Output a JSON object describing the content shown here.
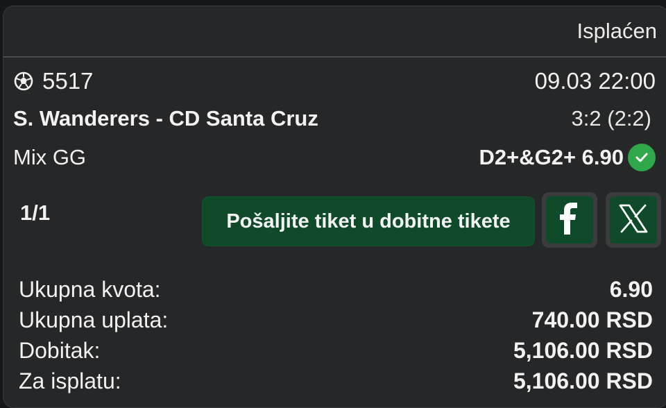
{
  "ticket": {
    "status": "Isplaćen",
    "match_id": "5517",
    "datetime": "09.03 22:00",
    "teams": "S. Wanderers - CD Santa Cruz",
    "score": "3:2 (2:2)",
    "bet_type": "Mix GG",
    "pick": "D2+&G2+ 6.90",
    "count": "1/1"
  },
  "actions": {
    "send_label": "Pošaljite tiket u dobitne tikete",
    "facebook_icon": "facebook-icon",
    "x_icon": "x-icon"
  },
  "summary": [
    {
      "label": "Ukupna kvota:",
      "value": "6.90"
    },
    {
      "label": "Ukupna uplata:",
      "value": "740.00 RSD"
    },
    {
      "label": "Dobitak:",
      "value": "5,106.00 RSD"
    },
    {
      "label": "Za isplatu:",
      "value": "5,106.00 RSD"
    }
  ],
  "colors": {
    "background": "#262728",
    "accent_green": "#0f4a2a",
    "check_green": "#2ea84a"
  }
}
